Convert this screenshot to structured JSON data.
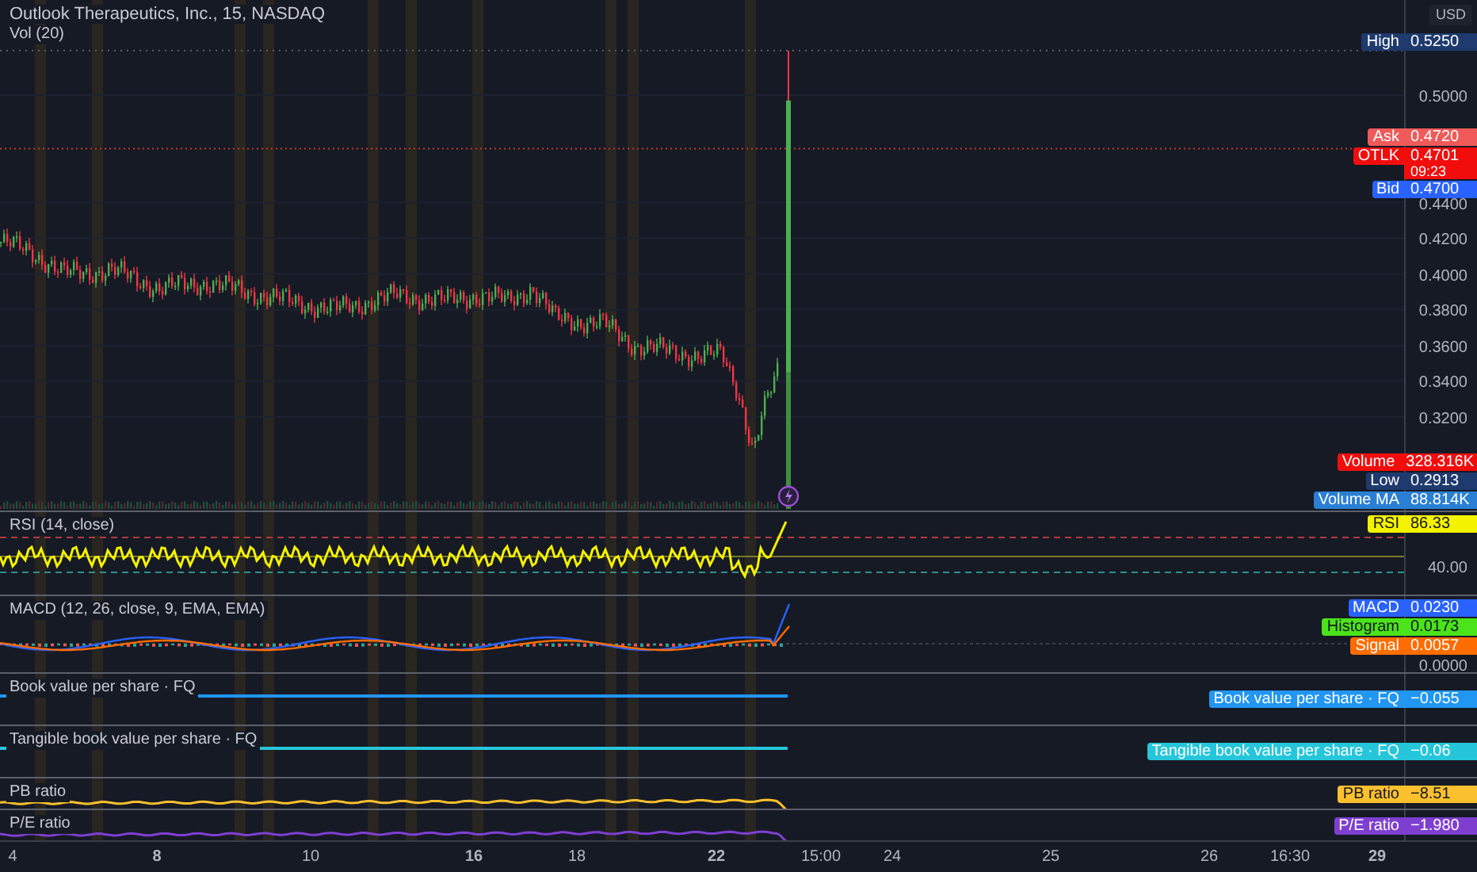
{
  "header": {
    "title": "Outlook Therapeutics, Inc., 15, NASDAQ",
    "volume_indicator": "Vol (20)"
  },
  "currency": "USD",
  "main_pane": {
    "ticks": [
      "0.5000",
      "0.4400",
      "0.4200",
      "0.4000",
      "0.3800",
      "0.3600",
      "0.3400",
      "0.3200"
    ],
    "price_tags": [
      {
        "label": "High",
        "value": "0.5250",
        "color": "#1e3a6e"
      },
      {
        "label": "Ask",
        "value": "0.4720",
        "color": "#f05a5a"
      },
      {
        "label": "OTLK",
        "value": "0.4701",
        "countdown": "09:23",
        "color": "#f20d0d"
      },
      {
        "label": "Bid",
        "value": "0.4700",
        "color": "#2962ff"
      }
    ],
    "bottom_tags": [
      {
        "label": "Volume",
        "value": "328.316K",
        "color": "#f20d0d"
      },
      {
        "label": "Low",
        "value": "0.2913",
        "color": "#1e3a6e"
      },
      {
        "label": "Volume MA",
        "value": "88.814K",
        "color": "#2a7fd4"
      }
    ]
  },
  "panes": [
    {
      "kind": "rsi",
      "title": "RSI (14, close)",
      "ticks": [
        "40.00"
      ],
      "tags": [
        {
          "label": "RSI",
          "value": "86.33",
          "color": "#f5f200"
        }
      ]
    },
    {
      "kind": "macd",
      "title": "MACD (12, 26, close, 9, EMA, EMA)",
      "ticks": [
        "0.0000"
      ],
      "tags": [
        {
          "label": "MACD",
          "value": "0.0230",
          "color": "#2962ff"
        },
        {
          "label": "Histogram",
          "value": "0.0173",
          "color": "#4be31a"
        },
        {
          "label": "Signal",
          "value": "0.0057",
          "color": "#ff6d00"
        }
      ]
    },
    {
      "kind": "flat",
      "title": "Book value per share · FQ",
      "tags": [
        {
          "label": "Book value per share · FQ",
          "value": "−0.055",
          "color": "#2196f3"
        }
      ]
    },
    {
      "kind": "flat",
      "title": "Tangible book value per share · FQ",
      "tags": [
        {
          "label": "Tangible book value per share · FQ",
          "value": "−0.06",
          "color": "#26c6da"
        }
      ]
    },
    {
      "kind": "ratio",
      "title": "PB ratio",
      "tags": [
        {
          "label": "PB ratio",
          "value": "−8.51",
          "color": "#fbc02d"
        }
      ]
    },
    {
      "kind": "ratio",
      "title": "P/E ratio",
      "tags": [
        {
          "label": "P/E ratio",
          "value": "−1.980",
          "color": "#7e3fd1"
        }
      ]
    }
  ],
  "time_axis": [
    {
      "label": "4",
      "bold": false
    },
    {
      "label": "8",
      "bold": true
    },
    {
      "label": "10",
      "bold": false
    },
    {
      "label": "16",
      "bold": true
    },
    {
      "label": "18",
      "bold": false
    },
    {
      "label": "22",
      "bold": true
    },
    {
      "label": "15:00",
      "bold": false
    },
    {
      "label": "24",
      "bold": false
    },
    {
      "label": "25",
      "bold": false
    },
    {
      "label": "26",
      "bold": false
    },
    {
      "label": "16:30",
      "bold": false
    },
    {
      "label": "29",
      "bold": true
    }
  ]
}
